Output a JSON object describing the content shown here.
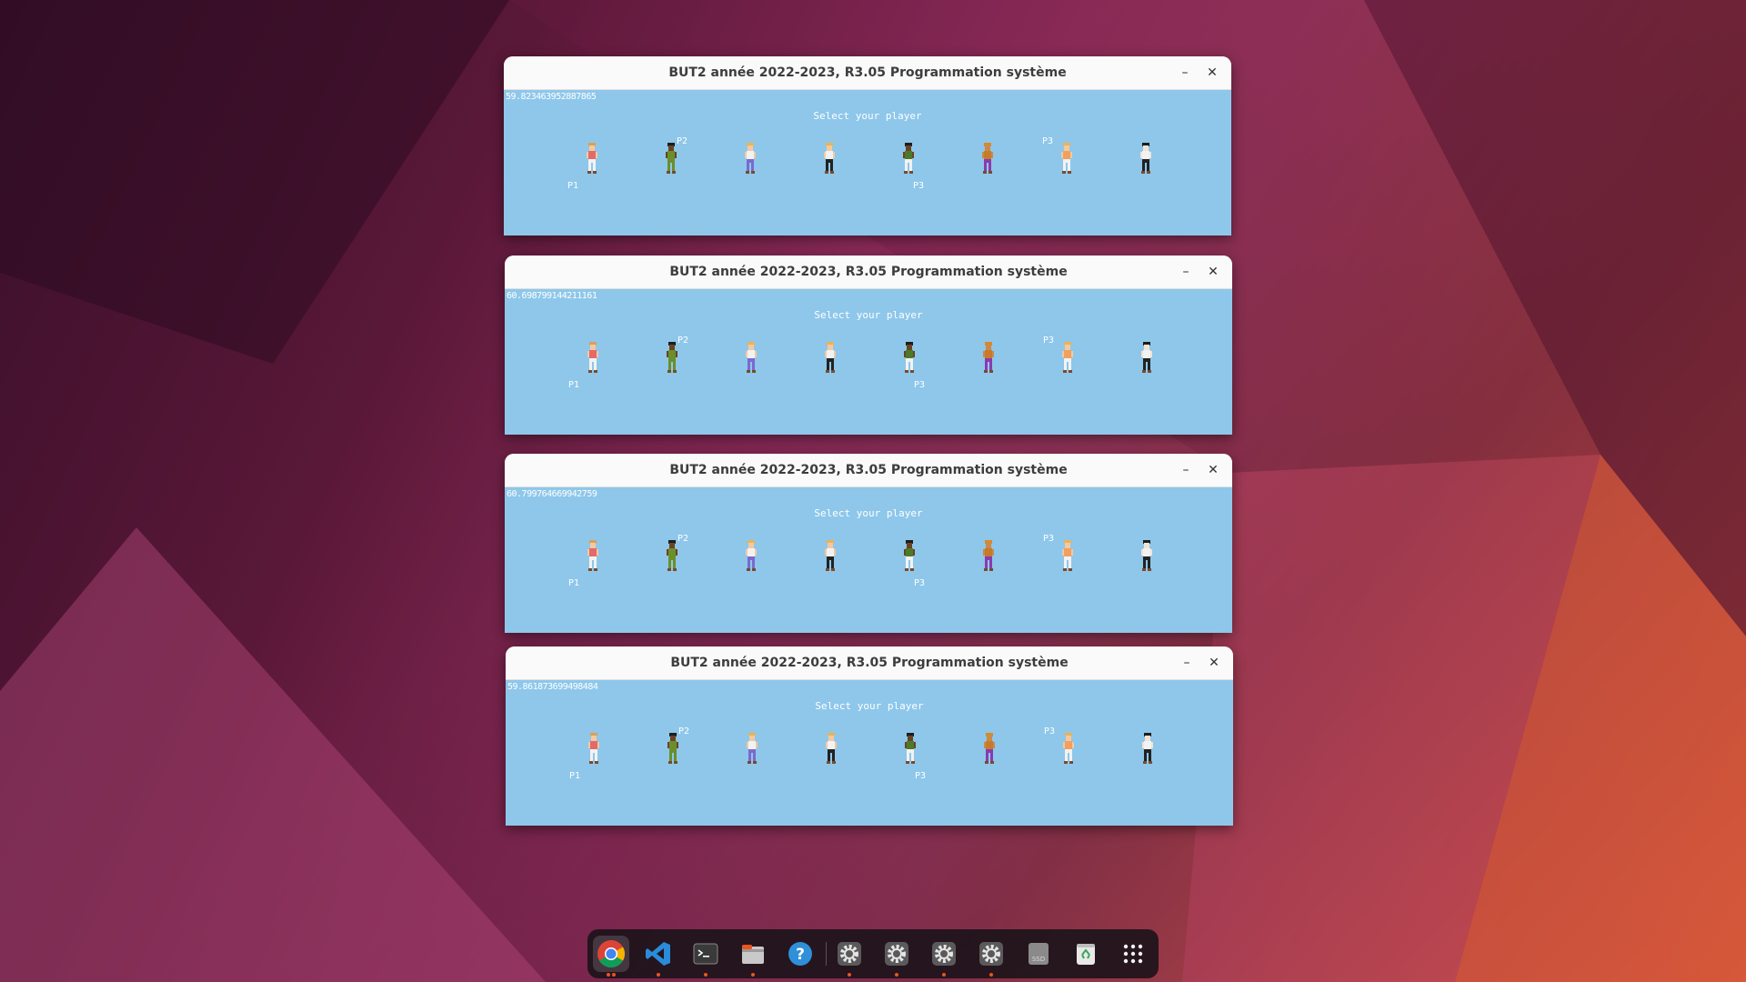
{
  "desktop": {
    "accent": "#e95420"
  },
  "windows": [
    {
      "title": "BUT2 année 2022-2023, R3.05 Programmation système",
      "fps": "59.823463952887865",
      "prompt": "Select your player",
      "labels": {
        "p1": "P1",
        "p2": "P2",
        "p3": "P3"
      }
    },
    {
      "title": "BUT2 année 2022-2023, R3.05 Programmation système",
      "fps": "60.698799144211161",
      "prompt": "Select your player",
      "labels": {
        "p1": "P1",
        "p2": "P2",
        "p3": "P3"
      }
    },
    {
      "title": "BUT2 année 2022-2023, R3.05 Programmation système",
      "fps": "60.799764669942759",
      "prompt": "Select your player",
      "labels": {
        "p1": "P1",
        "p2": "P2",
        "p3": "P3"
      }
    },
    {
      "title": "BUT2 année 2022-2023, R3.05 Programmation système",
      "fps": "59.861873699498484",
      "prompt": "Select your player",
      "labels": {
        "p1": "P1",
        "p2": "P2",
        "p3": "P3"
      }
    }
  ],
  "window_buttons": {
    "minimize": "–",
    "close": "✕"
  },
  "characters": [
    {
      "name": "character-1",
      "hair": "#d9a05b",
      "shirt": "#e46a6a",
      "pants": "#f2f2f2",
      "skin": "#f3c9a0"
    },
    {
      "name": "character-2",
      "hair": "#1d1d1d",
      "shirt": "#6b8f2a",
      "pants": "#6b8f2a",
      "skin": "#6a4324"
    },
    {
      "name": "character-3",
      "hair": "#e8b35a",
      "shirt": "#f2f2f2",
      "pants": "#7a6ad0",
      "skin": "#f3c9a0"
    },
    {
      "name": "character-4",
      "hair": "#e8b35a",
      "shirt": "#f2f2f2",
      "pants": "#222222",
      "skin": "#f3c9a0"
    },
    {
      "name": "character-5",
      "hair": "#1d1d1d",
      "shirt": "#4d7a2a",
      "pants": "#f2f2f2",
      "skin": "#6a4324"
    },
    {
      "name": "character-6",
      "hair": "#d68a2a",
      "shirt": "#c77a2a",
      "pants": "#8a3ab0",
      "skin": "#c98a4a"
    },
    {
      "name": "character-7",
      "hair": "#e8b35a",
      "shirt": "#f0a060",
      "pants": "#f2f2f2",
      "skin": "#f3c9a0"
    },
    {
      "name": "character-8",
      "hair": "#1d1d1d",
      "shirt": "#f2f2f2",
      "pants": "#222222",
      "skin": "#f3e3d3"
    }
  ],
  "dock": {
    "items": [
      {
        "name": "chrome-icon",
        "running": 2,
        "active": true
      },
      {
        "name": "vscode-icon",
        "running": 1
      },
      {
        "name": "terminal-icon",
        "running": 1
      },
      {
        "name": "files-icon",
        "running": 1
      },
      {
        "name": "help-icon",
        "running": 0
      },
      {
        "name": "settings-icon",
        "running": 1
      },
      {
        "name": "settings-icon",
        "running": 1
      },
      {
        "name": "settings-icon",
        "running": 1
      },
      {
        "name": "settings-icon",
        "running": 1
      },
      {
        "name": "ssd-icon",
        "running": 0,
        "text": "SSD"
      },
      {
        "name": "trash-icon",
        "running": 0
      },
      {
        "name": "app-grid-icon",
        "running": 0
      }
    ]
  }
}
